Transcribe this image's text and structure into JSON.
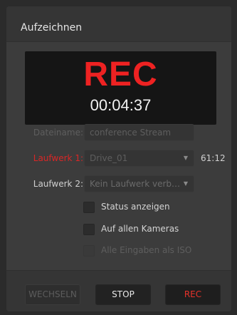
{
  "window": {
    "title": "Aufzeichnen"
  },
  "recorder": {
    "status_label": "REC",
    "timecode": "00:04:37"
  },
  "form": {
    "filename_label": "Dateiname:",
    "filename_value": "conference Stream",
    "drive1_label": "Laufwerk 1:",
    "drive1_value": "Drive_01",
    "drive1_remaining": "61:12",
    "drive2_label": "Laufwerk 2:",
    "drive2_value": "Kein Laufwerk verb…",
    "dropdown_caret": "▼"
  },
  "options": {
    "show_status": {
      "label": "Status anzeigen",
      "checked": false
    },
    "all_cameras": {
      "label": "Auf allen Kameras",
      "checked": false
    },
    "all_inputs_iso": {
      "label": "Alle Eingaben als ISO",
      "checked": false,
      "enabled": false
    }
  },
  "buttons": {
    "switch_label": "WECHSELN",
    "stop_label": "STOP",
    "rec_label": "REC"
  },
  "colors": {
    "rec_red": "#ee2222",
    "panel_bg": "#3c3c3c",
    "display_bg": "#151515",
    "disabled_text": "#5e5e5e"
  }
}
